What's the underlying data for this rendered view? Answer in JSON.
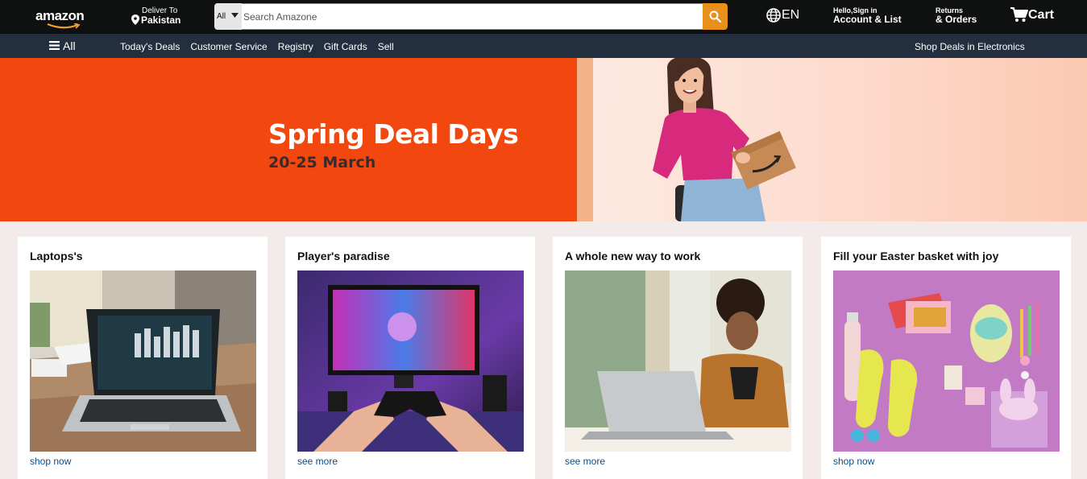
{
  "header": {
    "logo_text": "amazon",
    "deliver_small": "Deliver To",
    "deliver_location": "Pakistan",
    "search_category": "All",
    "search_placeholder": "Search Amazone",
    "language": "EN",
    "account_small": "Hello,Sign in",
    "account_big": "Account & List",
    "returns_small": "Returns",
    "returns_big": "& Orders",
    "cart_label": "Cart"
  },
  "nav": {
    "all_label": "All",
    "links": [
      "Today's Deals",
      "Customer Service",
      "Registry",
      "Gift Cards",
      "Sell"
    ],
    "right_link": "Shop Deals in Electronics"
  },
  "hero": {
    "title": "Spring Deal Days",
    "subtitle": "20-25 March"
  },
  "cards": [
    {
      "title": "Laptops's",
      "link": "shop now"
    },
    {
      "title": "Player's paradise",
      "link": "see more"
    },
    {
      "title": "A whole new way to work",
      "link": "see more"
    },
    {
      "title": "Fill your Easter basket with joy",
      "link": "shop now"
    }
  ],
  "colors": {
    "header_bg": "#0f1111",
    "nav_bg": "#232f3e",
    "search_button": "#e8901c",
    "hero_orange": "#f2480f",
    "link_blue": "#0a4e8a",
    "page_bg": "#f3eaea"
  },
  "icons": [
    "amazon-smile-icon",
    "location-pin-icon",
    "caret-down-icon",
    "search-icon",
    "globe-icon",
    "cart-icon",
    "hamburger-icon"
  ]
}
